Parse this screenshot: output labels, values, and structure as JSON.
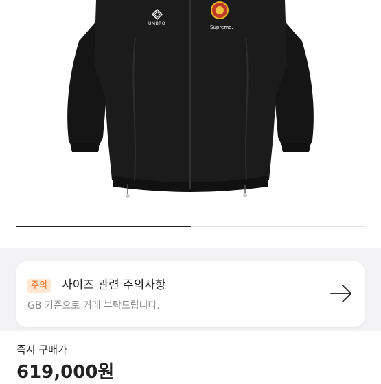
{
  "product": {
    "brand_logo_text": "UMBRO",
    "supreme_text": "Supreme."
  },
  "carousel": {
    "progress": 0.5
  },
  "notice": {
    "badge": "주의",
    "title": "사이즈 관련 주의사항",
    "subtitle": "GB 기준으로 거래 부탁드립니다.",
    "arrow_icon": "arrow-right-icon",
    "badge_bg": "#ffe8d1",
    "badge_color": "#f56d1f"
  },
  "price": {
    "label": "즉시 구매가",
    "value": "619,000원"
  }
}
